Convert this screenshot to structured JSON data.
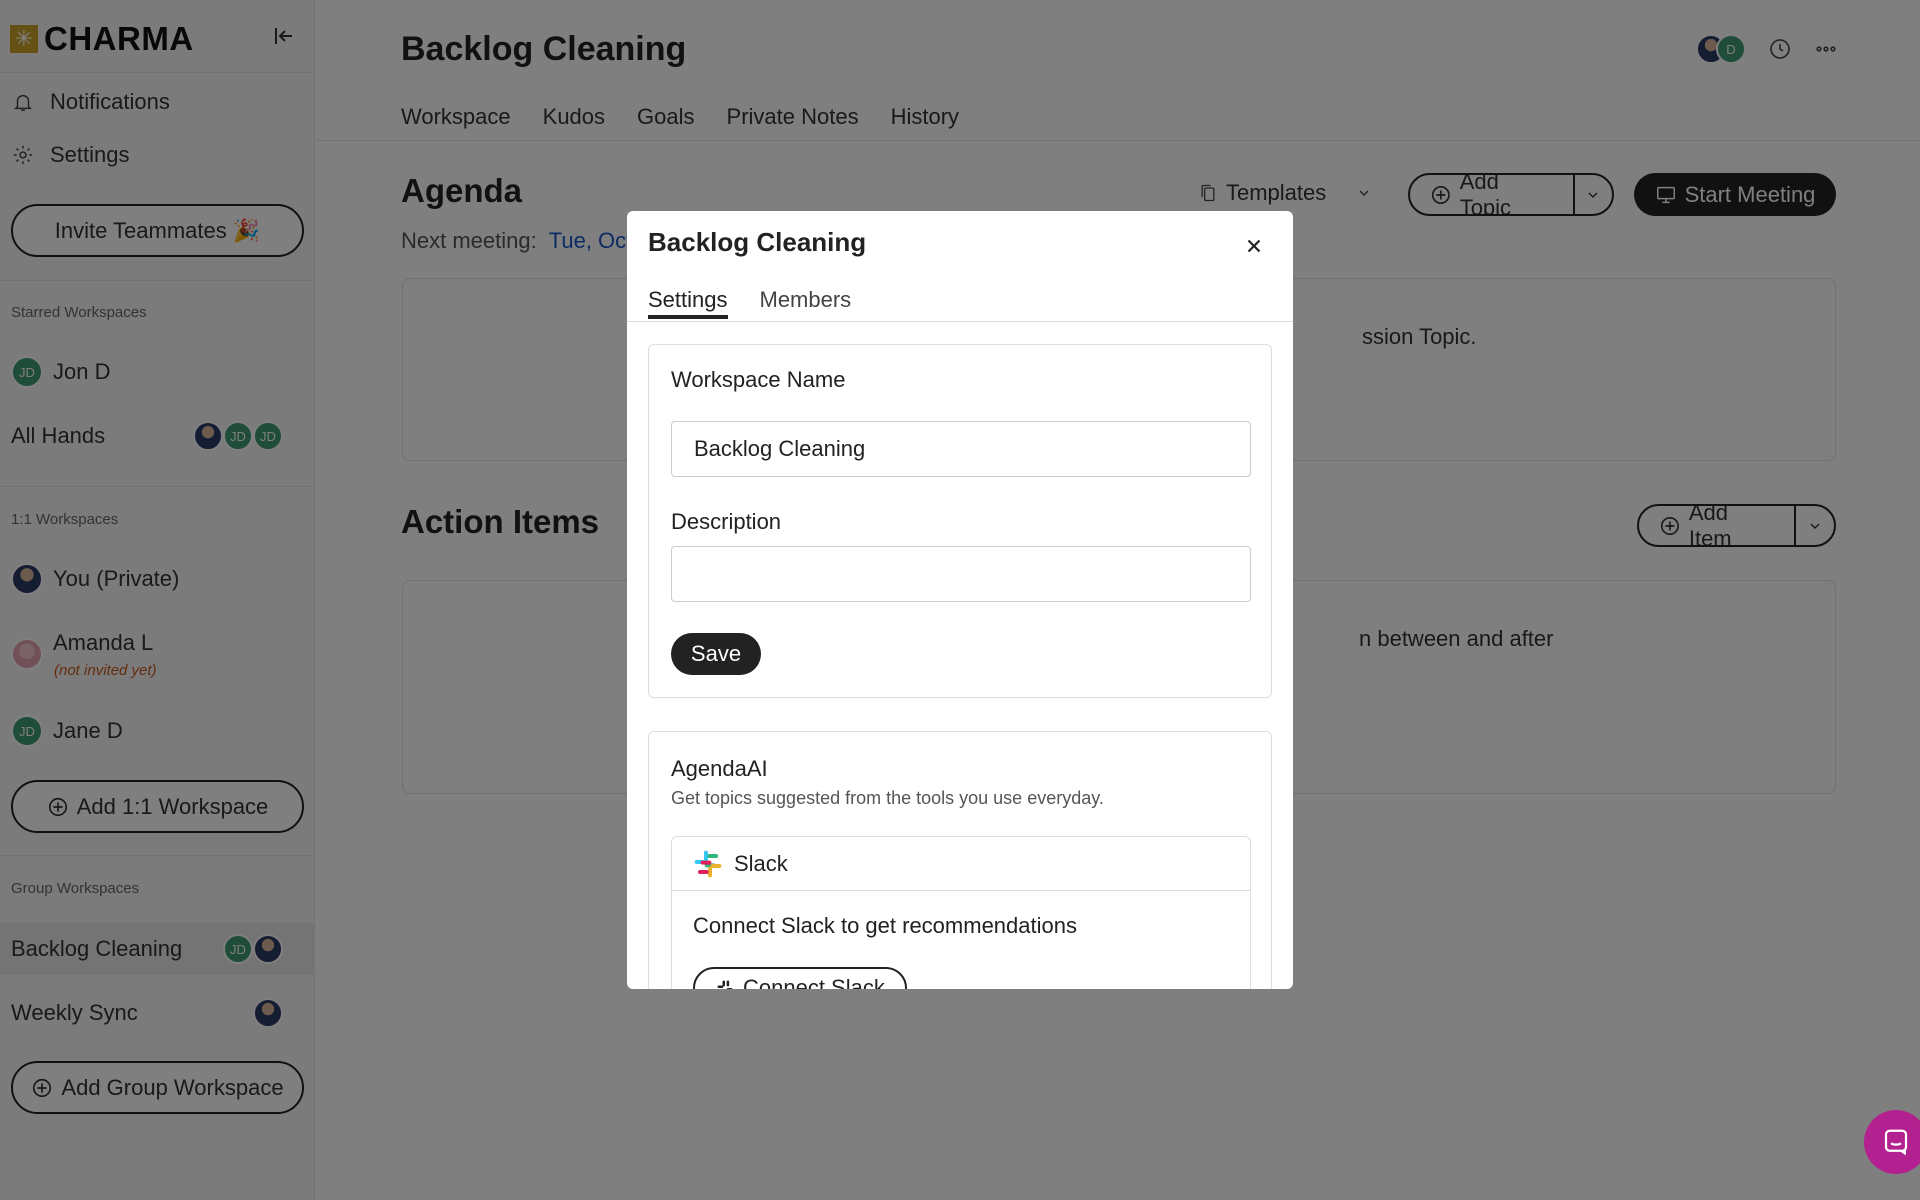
{
  "app": {
    "logo_text": "CHARMA"
  },
  "sidebar": {
    "nav": [
      {
        "label": "Notifications",
        "icon": "bell-icon"
      },
      {
        "label": "Settings",
        "icon": "gear-icon"
      }
    ],
    "invite_label": "Invite Teammates 🎉",
    "starred_title": "Starred Workspaces",
    "starred": [
      {
        "label": "Jon D",
        "initials": "JD"
      },
      {
        "label": "All Hands",
        "avatars": [
          "photo",
          "JD",
          "JD"
        ]
      }
    ],
    "one_on_one_title": "1:1 Workspaces",
    "one_on_one": [
      {
        "label": "You (Private)"
      },
      {
        "label": "Amanda L",
        "note": "(not invited yet)"
      },
      {
        "label": "Jane D",
        "initials": "JD"
      }
    ],
    "add_one_on_one_label": "Add 1:1 Workspace",
    "group_title": "Group Workspaces",
    "groups": [
      {
        "label": "Backlog Cleaning",
        "active": true,
        "avatars": [
          "JD",
          "photo"
        ]
      },
      {
        "label": "Weekly Sync",
        "avatars": [
          "photo"
        ]
      }
    ],
    "add_group_label": "Add Group Workspace"
  },
  "main": {
    "title": "Backlog Cleaning",
    "header_avatar_initial": "D",
    "tabs": [
      "Workspace",
      "Kudos",
      "Goals",
      "Private Notes",
      "History"
    ],
    "agenda_title": "Agenda",
    "next_meeting_label": "Next meeting:",
    "next_meeting_value": "Tue, Oct",
    "templates_label": "Templates",
    "add_topic_label": "Add Topic",
    "start_meeting_label": "Start Meeting",
    "agenda_hint_partial": "ssion Topic.",
    "action_items_title": "Action Items",
    "add_item_label": "Add Item",
    "action_hint_partial": "n between and after"
  },
  "modal": {
    "title": "Backlog Cleaning",
    "tabs": [
      "Settings",
      "Members"
    ],
    "workspace_name_label": "Workspace Name",
    "workspace_name_value": "Backlog Cleaning",
    "description_label": "Description",
    "description_value": "",
    "save_label": "Save",
    "agendaai_title": "AgendaAI",
    "agendaai_subtitle": "Get topics suggested from the tools you use everyday.",
    "slack_label": "Slack",
    "slack_body": "Connect Slack to get recommendations",
    "connect_slack_label": "Connect Slack"
  },
  "colors": {
    "overlay": "rgba(0,0,0,0.5)",
    "link": "#1a56c7",
    "chat_fab": "#b3208f",
    "avatar_green": "#3f9a72"
  }
}
